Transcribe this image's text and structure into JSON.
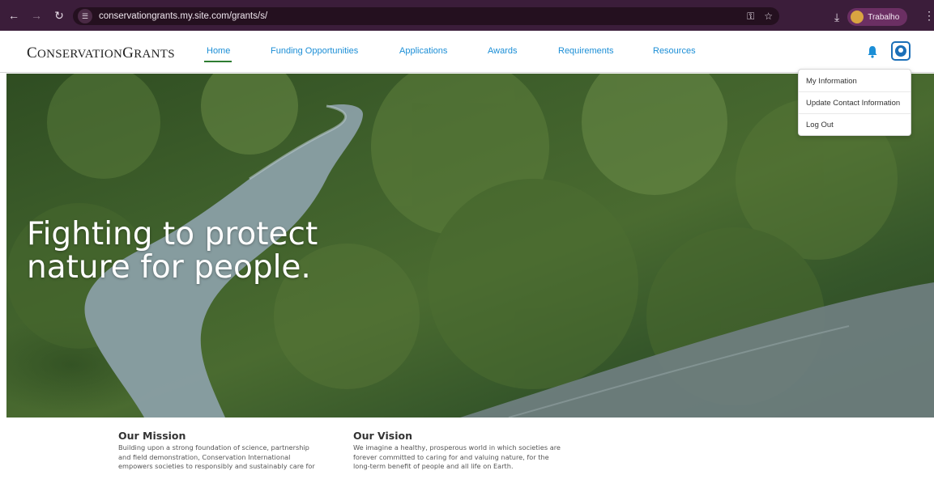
{
  "browser": {
    "url": "conservationgrants.my.site.com/grants/s/",
    "profile_label": "Trabalho",
    "icons": [
      "back-icon",
      "forward-icon",
      "reload-icon",
      "site-info-icon",
      "password-key-icon",
      "bookmark-star-icon",
      "download-icon",
      "kebab-icon"
    ]
  },
  "header": {
    "logo_big_c": "C",
    "logo_rest1": "ONSERVATION",
    "logo_big_g": "G",
    "logo_rest2": "RANTS",
    "nav": {
      "home": "Home",
      "funding": "Funding Opportunities",
      "applications": "Applications",
      "awards": "Awards",
      "requirements": "Requirements",
      "resources": "Resources"
    },
    "accent_color": "#1b8ed6"
  },
  "user_menu": {
    "my_information": "My Information",
    "update_contact": "Update Contact Information",
    "log_out": "Log Out"
  },
  "hero": {
    "title_line1": "Fighting to protect",
    "title_line2": "nature for people."
  },
  "mission": {
    "title": "Our Mission",
    "line1": "Building upon a strong foundation of science, partnership",
    "line2": "and field demonstration, Conservation International",
    "line3": "empowers societies to responsibly and sustainably care for"
  },
  "vision": {
    "title": "Our Vision",
    "line1": "We imagine a healthy, prosperous world in which societies are",
    "line2": "forever committed to caring for and valuing nature, for the",
    "line3": "long-term benefit of people and all life on Earth."
  }
}
